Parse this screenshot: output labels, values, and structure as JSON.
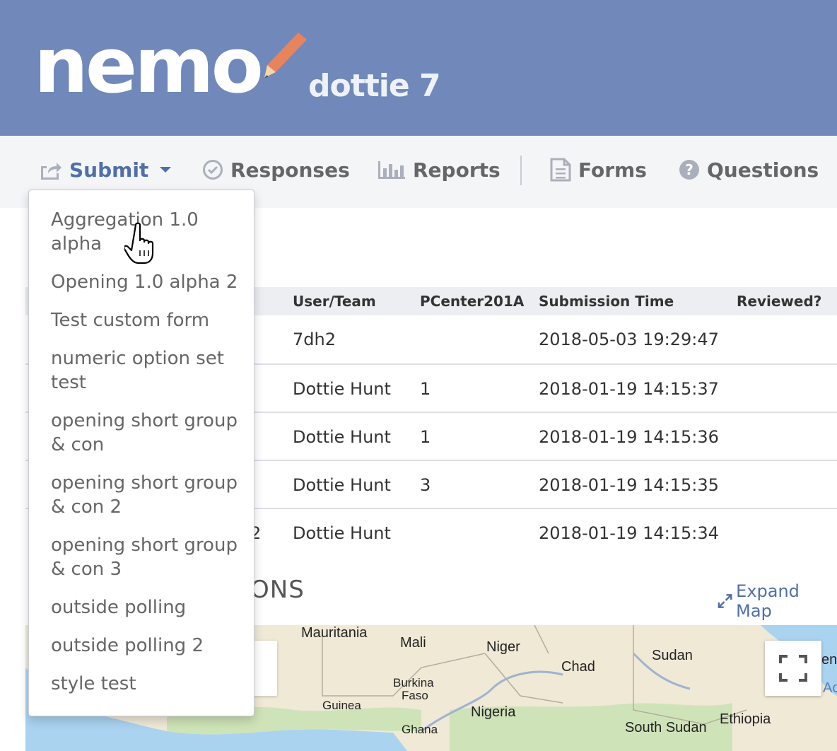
{
  "header": {
    "logo_text": "nemo",
    "mission_name": "dottie 7",
    "colors": {
      "header_bg": "#7089ba",
      "pencil": "#e8845b",
      "accent": "#4f6fa8"
    }
  },
  "nav": {
    "submit": {
      "label": "Submit",
      "icon": "share-icon"
    },
    "responses": {
      "label": "Responses",
      "icon": "check-circle-icon"
    },
    "reports": {
      "label": "Reports",
      "icon": "bar-chart-icon"
    },
    "forms": {
      "label": "Forms",
      "icon": "document-icon"
    },
    "questions": {
      "label": "Questions",
      "icon": "question-circle-icon"
    }
  },
  "dropdown": {
    "items": [
      "Aggregation 1.0 alpha",
      "Opening 1.0 alpha 2",
      "Test custom form",
      "numeric option set test",
      "opening short group & con",
      "opening short group & con 2",
      "opening short group & con 3",
      "outside polling",
      "outside polling 2",
      "style test"
    ]
  },
  "responses_section": {
    "title_fragment": "S",
    "columns": [
      "User/Team",
      "PCenter201A",
      "Submission Time",
      "Reviewed?"
    ],
    "rows": [
      {
        "user": "7dh2",
        "pcenter": "",
        "time": "2018-05-03 19:29:47",
        "reviewed": ""
      },
      {
        "user": "Dottie Hunt",
        "pcenter": "1",
        "time": "2018-01-19 14:15:37",
        "reviewed": ""
      },
      {
        "user": "Dottie Hunt",
        "pcenter": "1",
        "time": "2018-01-19 14:15:36",
        "reviewed": ""
      },
      {
        "user": "Dottie Hunt",
        "pcenter": "3",
        "time": "2018-01-19 14:15:35",
        "reviewed": ""
      },
      {
        "user": "Dottie Hunt",
        "pcenter": "",
        "time": "2018-01-19 14:15:34",
        "reviewed": ""
      }
    ],
    "partial_cell": "2"
  },
  "map_section": {
    "title_fragment": "ONS",
    "expand_label": "Expand Map",
    "labels": [
      "Mauritania",
      "Mali",
      "Niger",
      "Sudan",
      "Chad",
      "Burkina",
      "Faso",
      "Guinea",
      "Nigeria",
      "Ghana",
      "South Sudan",
      "Ethiopia"
    ],
    "edge_fragments": [
      "en",
      "Ac"
    ]
  }
}
